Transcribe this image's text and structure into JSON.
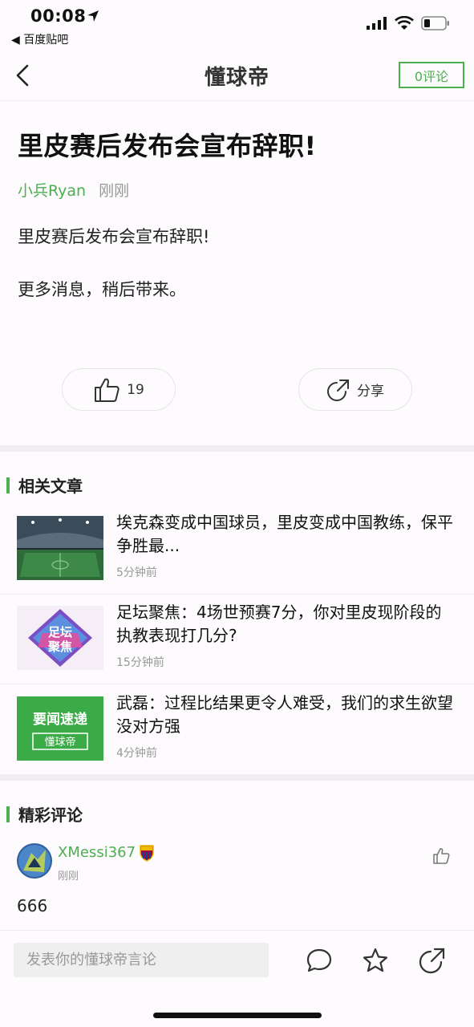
{
  "status_bar": {
    "time": "00:08",
    "back_app": "◀ 百度贴吧"
  },
  "nav": {
    "logo": "懂球帝",
    "comment_count_label": "0评论"
  },
  "article": {
    "title": "里皮赛后发布会宣布辞职!",
    "author": "小兵Ryan",
    "time": "刚刚",
    "paragraphs": [
      "里皮赛后发布会宣布辞职!",
      "更多消息，稍后带来。"
    ],
    "like_count": "19",
    "share_label": "分享"
  },
  "related": {
    "heading": "相关文章",
    "items": [
      {
        "title": "埃克森变成中国球员，里皮变成中国教练，保平争胜最...",
        "time": "5分钟前"
      },
      {
        "title": "足坛聚焦：4场世预赛7分，你对里皮现阶段的执教表现打几分?",
        "time": "15分钟前",
        "thumb_text": [
          "足坛",
          "聚焦"
        ]
      },
      {
        "title": "武磊：过程比结果更令人难受，我们的求生欲望没对方强",
        "time": "4分钟前",
        "thumb_text": [
          "要闻速递",
          "懂球帝"
        ]
      }
    ]
  },
  "comments": {
    "heading": "精彩评论",
    "items": [
      {
        "user": "XMessi367",
        "time": "刚刚",
        "text": "666"
      }
    ]
  },
  "bottom_bar": {
    "input_placeholder": "发表你的懂球帝言论"
  },
  "colors": {
    "accent": "#4caf50",
    "divider": "#f0eef0"
  }
}
